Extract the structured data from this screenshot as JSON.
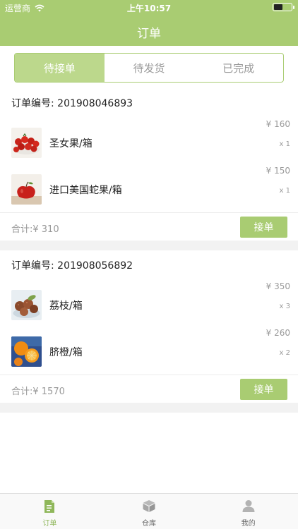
{
  "status_bar": {
    "carrier": "运营商",
    "time": "上午10:57"
  },
  "nav": {
    "title": "订单"
  },
  "tabs": [
    "待接单",
    "待发货",
    "已完成"
  ],
  "colors": {
    "brand": "#a9cc72",
    "tab_active": "#bcd88c",
    "label_active": "#8fb75a"
  },
  "orders": [
    {
      "number": "订单编号: 201908046893",
      "items": [
        {
          "name": "圣女果/箱",
          "price": "¥ 160",
          "qty": "x 1",
          "thumb": "cherry-tomatoes"
        },
        {
          "name": "进口美国蛇果/箱",
          "price": "¥ 150",
          "qty": "x 1",
          "thumb": "red-apple"
        }
      ],
      "total": "合计:¥ 310",
      "action": "接单"
    },
    {
      "number": "订单编号: 201908056892",
      "items": [
        {
          "name": "荔枝/箱",
          "price": "¥ 350",
          "qty": "x 3",
          "thumb": "lychee"
        },
        {
          "name": "脐橙/箱",
          "price": "¥ 260",
          "qty": "x 2",
          "thumb": "navel-orange"
        }
      ],
      "total": "合计:¥ 1570",
      "action": "接单"
    }
  ],
  "tabbar": [
    {
      "label": "订单",
      "icon": "order-icon",
      "active": true
    },
    {
      "label": "仓库",
      "icon": "warehouse-icon",
      "active": false
    },
    {
      "label": "我的",
      "icon": "profile-icon",
      "active": false
    }
  ]
}
